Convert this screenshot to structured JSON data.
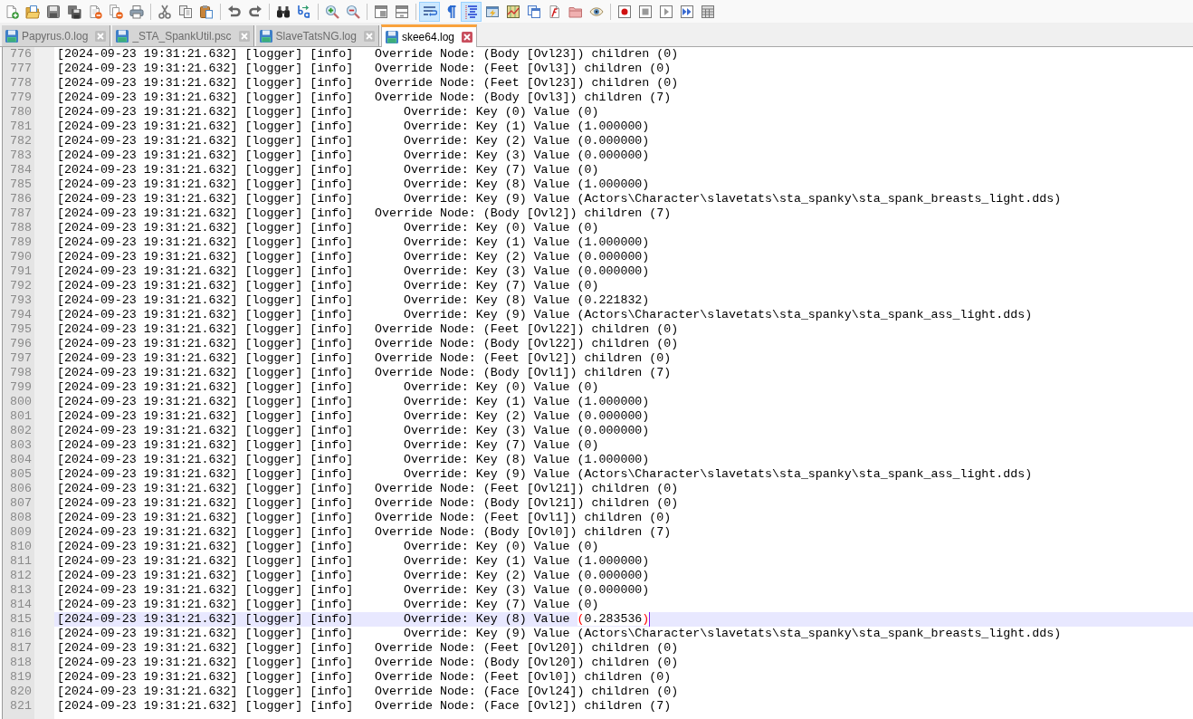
{
  "toolbar": [
    {
      "buttons": [
        {
          "kind": "new",
          "pressed": false
        },
        {
          "kind": "open",
          "pressed": false
        },
        {
          "kind": "save",
          "pressed": false
        },
        {
          "kind": "saveall",
          "pressed": false
        },
        {
          "kind": "close",
          "pressed": false
        },
        {
          "kind": "closeall",
          "pressed": false
        },
        {
          "kind": "print",
          "pressed": false
        }
      ]
    },
    {
      "buttons": [
        {
          "kind": "cut",
          "pressed": false
        },
        {
          "kind": "copy",
          "pressed": false
        },
        {
          "kind": "paste",
          "pressed": false
        }
      ]
    },
    {
      "buttons": [
        {
          "kind": "undo",
          "pressed": false
        },
        {
          "kind": "redo",
          "pressed": false
        }
      ]
    },
    {
      "buttons": [
        {
          "kind": "find",
          "pressed": false
        },
        {
          "kind": "replace",
          "pressed": false
        }
      ]
    },
    {
      "buttons": [
        {
          "kind": "zoomin",
          "pressed": false
        },
        {
          "kind": "zoomout",
          "pressed": false
        }
      ]
    },
    {
      "buttons": [
        {
          "kind": "syncv",
          "pressed": false
        },
        {
          "kind": "synch",
          "pressed": false
        }
      ]
    },
    {
      "buttons": [
        {
          "kind": "wrap",
          "pressed": true
        },
        {
          "kind": "allchars",
          "pressed": false
        },
        {
          "kind": "indent",
          "pressed": true
        },
        {
          "kind": "udl",
          "pressed": false
        },
        {
          "kind": "docmap",
          "pressed": false
        },
        {
          "kind": "doclist",
          "pressed": false
        },
        {
          "kind": "funclist",
          "pressed": false
        },
        {
          "kind": "folder",
          "pressed": false
        },
        {
          "kind": "monitor",
          "pressed": false
        }
      ]
    },
    {
      "buttons": [
        {
          "kind": "record",
          "pressed": false
        },
        {
          "kind": "stop",
          "pressed": false
        },
        {
          "kind": "play",
          "pressed": false
        },
        {
          "kind": "playmulti",
          "pressed": false
        },
        {
          "kind": "savemacro",
          "pressed": false
        }
      ]
    }
  ],
  "tabs": [
    {
      "label": "Papyrus.0.log",
      "selected": false
    },
    {
      "label": "_STA_SpankUtil.psc",
      "selected": false
    },
    {
      "label": "SlaveTatsNG.log",
      "selected": false
    },
    {
      "label": "skee64.log",
      "selected": true
    }
  ],
  "lines": [
    {
      "number": "776",
      "text": "[2024-09-23 19:31:21.632] [logger] [info]   Override Node: (Body [Ovl23]) children (0)",
      "current": false
    },
    {
      "number": "777",
      "text": "[2024-09-23 19:31:21.632] [logger] [info]   Override Node: (Feet [Ovl3]) children (0)",
      "current": false
    },
    {
      "number": "778",
      "text": "[2024-09-23 19:31:21.632] [logger] [info]   Override Node: (Feet [Ovl23]) children (0)",
      "current": false
    },
    {
      "number": "779",
      "text": "[2024-09-23 19:31:21.632] [logger] [info]   Override Node: (Body [Ovl3]) children (7)",
      "current": false
    },
    {
      "number": "780",
      "text": "[2024-09-23 19:31:21.632] [logger] [info]       Override: Key (0) Value (0)",
      "current": false
    },
    {
      "number": "781",
      "text": "[2024-09-23 19:31:21.632] [logger] [info]       Override: Key (1) Value (1.000000)",
      "current": false
    },
    {
      "number": "782",
      "text": "[2024-09-23 19:31:21.632] [logger] [info]       Override: Key (2) Value (0.000000)",
      "current": false
    },
    {
      "number": "783",
      "text": "[2024-09-23 19:31:21.632] [logger] [info]       Override: Key (3) Value (0.000000)",
      "current": false
    },
    {
      "number": "784",
      "text": "[2024-09-23 19:31:21.632] [logger] [info]       Override: Key (7) Value (0)",
      "current": false
    },
    {
      "number": "785",
      "text": "[2024-09-23 19:31:21.632] [logger] [info]       Override: Key (8) Value (1.000000)",
      "current": false
    },
    {
      "number": "786",
      "text": "[2024-09-23 19:31:21.632] [logger] [info]       Override: Key (9) Value (Actors\\Character\\slavetats\\sta_spanky\\sta_spank_breasts_light.dds)",
      "current": false
    },
    {
      "number": "787",
      "text": "[2024-09-23 19:31:21.632] [logger] [info]   Override Node: (Body [Ovl2]) children (7)",
      "current": false
    },
    {
      "number": "788",
      "text": "[2024-09-23 19:31:21.632] [logger] [info]       Override: Key (0) Value (0)",
      "current": false
    },
    {
      "number": "789",
      "text": "[2024-09-23 19:31:21.632] [logger] [info]       Override: Key (1) Value (1.000000)",
      "current": false
    },
    {
      "number": "790",
      "text": "[2024-09-23 19:31:21.632] [logger] [info]       Override: Key (2) Value (0.000000)",
      "current": false
    },
    {
      "number": "791",
      "text": "[2024-09-23 19:31:21.632] [logger] [info]       Override: Key (3) Value (0.000000)",
      "current": false
    },
    {
      "number": "792",
      "text": "[2024-09-23 19:31:21.632] [logger] [info]       Override: Key (7) Value (0)",
      "current": false
    },
    {
      "number": "793",
      "text": "[2024-09-23 19:31:21.632] [logger] [info]       Override: Key (8) Value (0.221832)",
      "current": false
    },
    {
      "number": "794",
      "text": "[2024-09-23 19:31:21.632] [logger] [info]       Override: Key (9) Value (Actors\\Character\\slavetats\\sta_spanky\\sta_spank_ass_light.dds)",
      "current": false
    },
    {
      "number": "795",
      "text": "[2024-09-23 19:31:21.632] [logger] [info]   Override Node: (Feet [Ovl22]) children (0)",
      "current": false
    },
    {
      "number": "796",
      "text": "[2024-09-23 19:31:21.632] [logger] [info]   Override Node: (Body [Ovl22]) children (0)",
      "current": false
    },
    {
      "number": "797",
      "text": "[2024-09-23 19:31:21.632] [logger] [info]   Override Node: (Feet [Ovl2]) children (0)",
      "current": false
    },
    {
      "number": "798",
      "text": "[2024-09-23 19:31:21.632] [logger] [info]   Override Node: (Body [Ovl1]) children (7)",
      "current": false
    },
    {
      "number": "799",
      "text": "[2024-09-23 19:31:21.632] [logger] [info]       Override: Key (0) Value (0)",
      "current": false
    },
    {
      "number": "800",
      "text": "[2024-09-23 19:31:21.632] [logger] [info]       Override: Key (1) Value (1.000000)",
      "current": false
    },
    {
      "number": "801",
      "text": "[2024-09-23 19:31:21.632] [logger] [info]       Override: Key (2) Value (0.000000)",
      "current": false
    },
    {
      "number": "802",
      "text": "[2024-09-23 19:31:21.632] [logger] [info]       Override: Key (3) Value (0.000000)",
      "current": false
    },
    {
      "number": "803",
      "text": "[2024-09-23 19:31:21.632] [logger] [info]       Override: Key (7) Value (0)",
      "current": false
    },
    {
      "number": "804",
      "text": "[2024-09-23 19:31:21.632] [logger] [info]       Override: Key (8) Value (1.000000)",
      "current": false
    },
    {
      "number": "805",
      "text": "[2024-09-23 19:31:21.632] [logger] [info]       Override: Key (9) Value (Actors\\Character\\slavetats\\sta_spanky\\sta_spank_ass_light.dds)",
      "current": false
    },
    {
      "number": "806",
      "text": "[2024-09-23 19:31:21.632] [logger] [info]   Override Node: (Feet [Ovl21]) children (0)",
      "current": false
    },
    {
      "number": "807",
      "text": "[2024-09-23 19:31:21.632] [logger] [info]   Override Node: (Body [Ovl21]) children (0)",
      "current": false
    },
    {
      "number": "808",
      "text": "[2024-09-23 19:31:21.632] [logger] [info]   Override Node: (Feet [Ovl1]) children (0)",
      "current": false
    },
    {
      "number": "809",
      "text": "[2024-09-23 19:31:21.632] [logger] [info]   Override Node: (Body [Ovl0]) children (7)",
      "current": false
    },
    {
      "number": "810",
      "text": "[2024-09-23 19:31:21.632] [logger] [info]       Override: Key (0) Value (0)",
      "current": false
    },
    {
      "number": "811",
      "text": "[2024-09-23 19:31:21.632] [logger] [info]       Override: Key (1) Value (1.000000)",
      "current": false
    },
    {
      "number": "812",
      "text": "[2024-09-23 19:31:21.632] [logger] [info]       Override: Key (2) Value (0.000000)",
      "current": false
    },
    {
      "number": "813",
      "text": "[2024-09-23 19:31:21.632] [logger] [info]       Override: Key (3) Value (0.000000)",
      "current": false
    },
    {
      "number": "814",
      "text": "[2024-09-23 19:31:21.632] [logger] [info]       Override: Key (7) Value (0)",
      "current": false
    },
    {
      "number": "815",
      "text": "[2024-09-23 19:31:21.632] [logger] [info]       Override: Key (8) Value ",
      "current": true,
      "brace_match": {
        "open": "(",
        "inner": "0.283536",
        "close": ")"
      }
    },
    {
      "number": "816",
      "text": "[2024-09-23 19:31:21.632] [logger] [info]       Override: Key (9) Value (Actors\\Character\\slavetats\\sta_spanky\\sta_spank_breasts_light.dds)",
      "current": false
    },
    {
      "number": "817",
      "text": "[2024-09-23 19:31:21.632] [logger] [info]   Override Node: (Feet [Ovl20]) children (0)",
      "current": false
    },
    {
      "number": "818",
      "text": "[2024-09-23 19:31:21.632] [logger] [info]   Override Node: (Body [Ovl20]) children (0)",
      "current": false
    },
    {
      "number": "819",
      "text": "[2024-09-23 19:31:21.632] [logger] [info]   Override Node: (Feet [Ovl0]) children (0)",
      "current": false
    },
    {
      "number": "820",
      "text": "[2024-09-23 19:31:21.632] [logger] [info]   Override Node: (Face [Ovl24]) children (0)",
      "current": false
    },
    {
      "number": "821",
      "text": "[2024-09-23 19:31:21.632] [logger] [info]   Override Node: (Face [Ovl2]) children (7)",
      "current": false
    }
  ]
}
